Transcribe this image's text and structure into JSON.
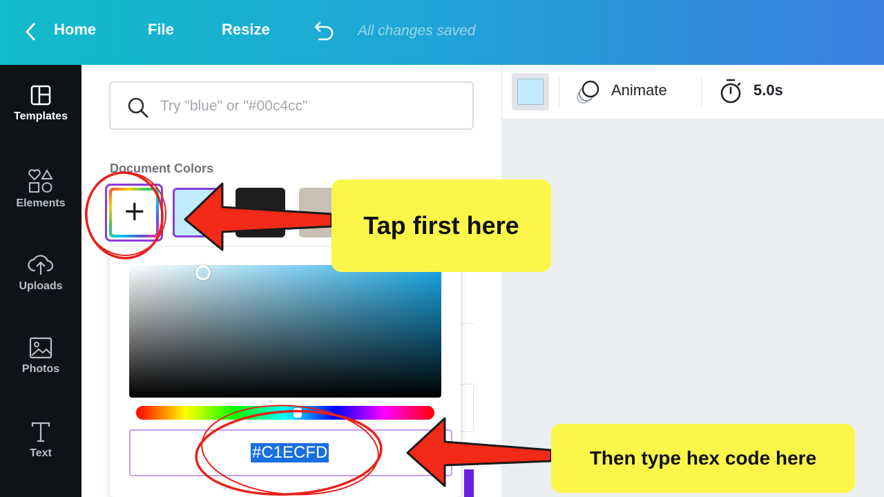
{
  "topbar": {
    "home_label": "Home",
    "file_label": "File",
    "resize_label": "Resize",
    "status_text": "All changes saved"
  },
  "rail": {
    "items": [
      {
        "label": "Templates",
        "icon": "templates-icon"
      },
      {
        "label": "Elements",
        "icon": "elements-icon"
      },
      {
        "label": "Uploads",
        "icon": "upload-cloud-icon"
      },
      {
        "label": "Photos",
        "icon": "image-icon"
      },
      {
        "label": "Text",
        "icon": "text-icon"
      }
    ]
  },
  "panel": {
    "search_placeholder": "Try \"blue\" or \"#00c4cc\"",
    "section_label": "Document Colors",
    "swatches": [
      "add-new",
      "#C1ECFD",
      "#1E1E1E",
      "#C8C0B2"
    ]
  },
  "picker": {
    "hex_value": "#C1ECFD"
  },
  "toolbar": {
    "selected_color": "#C1ECFD",
    "animate_label": "Animate",
    "duration_label": "5.0s"
  },
  "annotations": {
    "callout_1": "Tap first here",
    "callout_2": "Then type hex code here"
  },
  "colors": {
    "topbar_start": "#11BCCB",
    "topbar_end": "#3B7FE0",
    "rail_bg": "#0E1318",
    "annotation_red": "#E8201A",
    "callout_yellow": "#FDF64A"
  }
}
